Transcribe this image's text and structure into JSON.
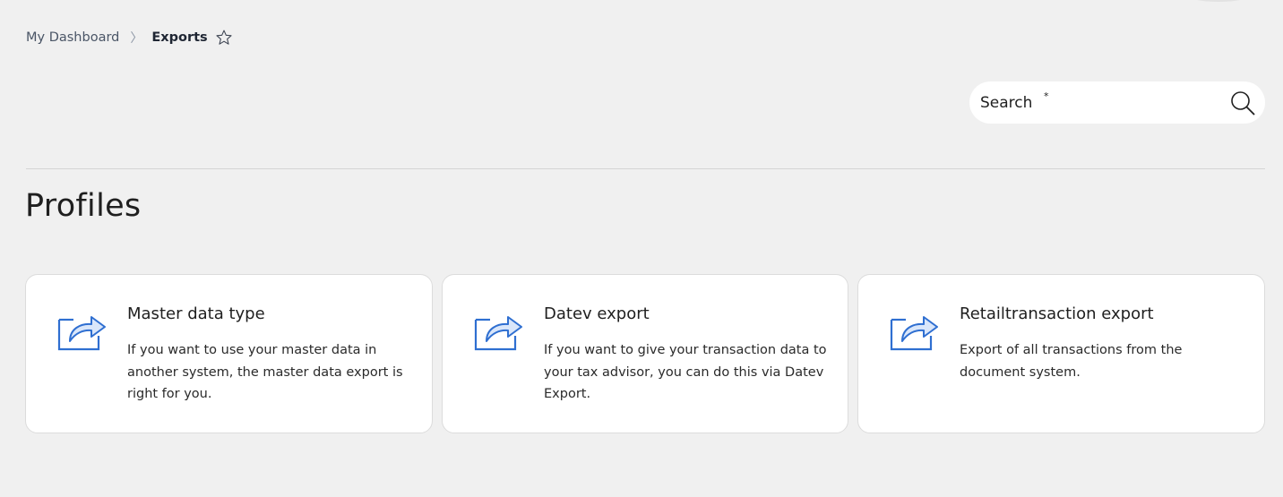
{
  "breadcrumb": {
    "home": "My Dashboard",
    "separator": "〉",
    "current": "Exports"
  },
  "search": {
    "label": "Search",
    "required_mark": "*",
    "placeholder": ""
  },
  "section": {
    "title": "Profiles"
  },
  "profiles": [
    {
      "title": "Master data type",
      "description": "If you want to use your master data in another system, the master data export is right for you.",
      "icon": "export-share-icon"
    },
    {
      "title": "Datev export",
      "description": "If you want to give your transaction data to your tax advisor, you can do this via Datev Export.",
      "icon": "export-share-icon"
    },
    {
      "title": "Retailtransaction export",
      "description": "Export of all transactions from the document system.",
      "icon": "export-share-icon"
    }
  ],
  "colors": {
    "background": "#f0f0f0",
    "card": "#ffffff",
    "icon_blue": "#2f6fd1",
    "icon_fill": "#d9e6fa"
  }
}
